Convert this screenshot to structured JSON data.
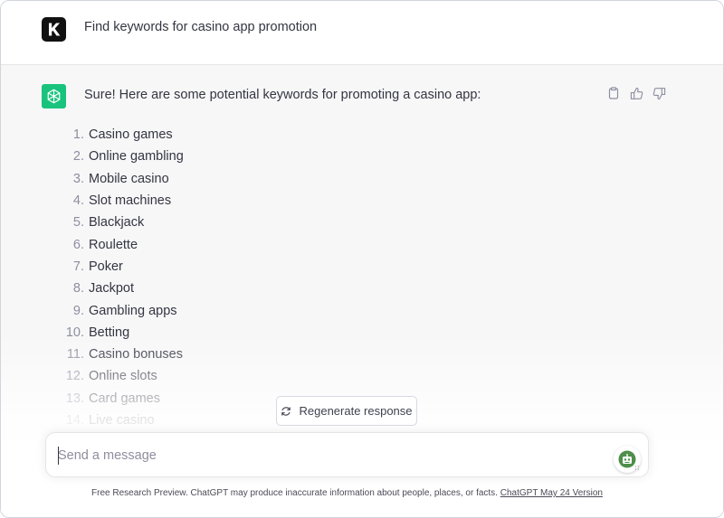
{
  "user_message": {
    "text": "Find keywords for casino app promotion",
    "avatar_letter": "K"
  },
  "assistant_message": {
    "intro": "Sure! Here are some potential keywords for promoting a casino app:",
    "avatar_icon": "openai-logo-icon",
    "keywords": [
      {
        "num": "1.",
        "label": "Casino games"
      },
      {
        "num": "2.",
        "label": "Online gambling"
      },
      {
        "num": "3.",
        "label": "Mobile casino"
      },
      {
        "num": "4.",
        "label": "Slot machines"
      },
      {
        "num": "5.",
        "label": "Blackjack"
      },
      {
        "num": "6.",
        "label": "Roulette"
      },
      {
        "num": "7.",
        "label": "Poker"
      },
      {
        "num": "8.",
        "label": "Jackpot"
      },
      {
        "num": "9.",
        "label": "Gambling apps"
      },
      {
        "num": "10.",
        "label": "Betting"
      },
      {
        "num": "11.",
        "label": "Casino bonuses"
      },
      {
        "num": "12.",
        "label": "Online slots"
      },
      {
        "num": "13.",
        "label": "Card games"
      },
      {
        "num": "14.",
        "label": "Live casino"
      }
    ],
    "actions": [
      "copy-icon",
      "thumbs-up-icon",
      "thumbs-down-icon"
    ]
  },
  "regenerate": {
    "label": "Regenerate response",
    "icon": "refresh-icon"
  },
  "composer": {
    "placeholder": "Send a message",
    "extension_icon": "robot-icon"
  },
  "footer": {
    "text": "Free Research Preview. ChatGPT may produce inaccurate information about people, places, or facts.",
    "link": "ChatGPT May 24 Version"
  },
  "colors": {
    "accent": "#19c37d",
    "assistant_bg": "#f7f7f8",
    "text": "#343541",
    "muted": "#8e8ea0"
  }
}
